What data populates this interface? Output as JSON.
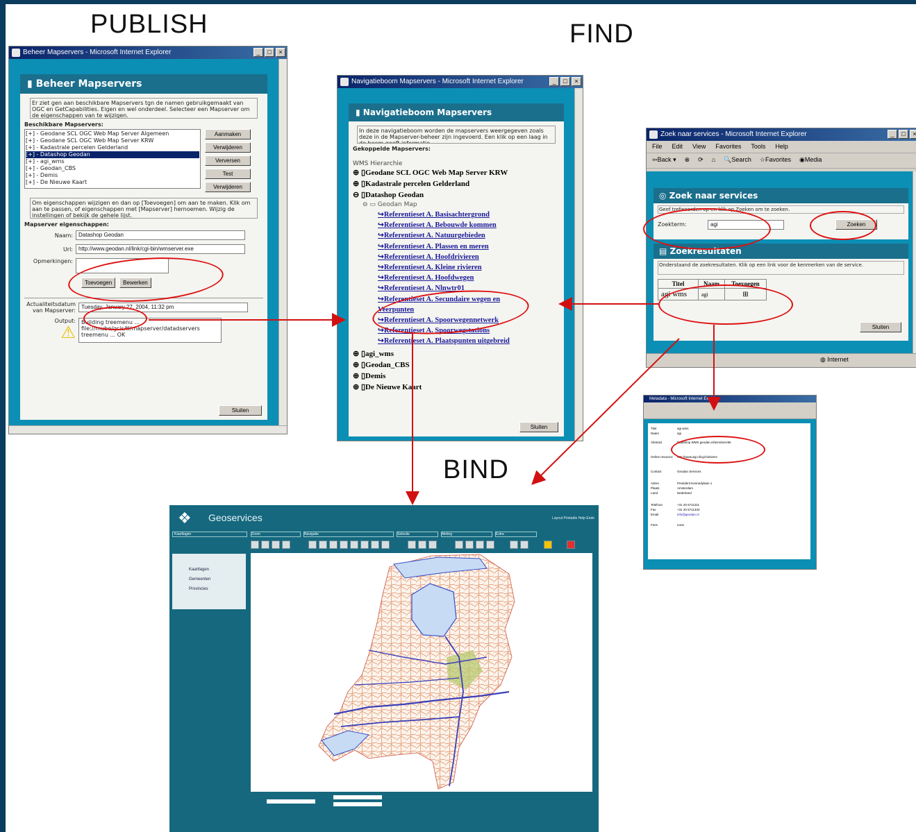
{
  "labels": {
    "publish": "PUBLISH",
    "find": "FIND",
    "bind": "BIND"
  },
  "publish_window": {
    "title": "Beheer Mapservers - Microsoft Internet Explorer",
    "panel_title": "Beheer Mapservers",
    "intro": "Er ziet gen aan beschikbare Mapservers tgn de namen gebruikgemaakt van OGC en GetCapabilities. Eigen en wel onderdeel. Selecteer een Mapserver om de eigenschappen van te wijzigen.",
    "list_label": "Beschikbare Mapservers:",
    "servers": [
      "Geodane SCL OGC Web Map Server Algemeen",
      "Geodane SCL OGC Web Map Server KRW",
      "Kadastrale percelen Gelderland",
      "Datashop Geodan",
      "agi_wms",
      "Geodan_CBS",
      "Demis",
      "De Nieuwe Kaart"
    ],
    "selected_server": "Datashop Geodan",
    "side_buttons": [
      "Aanmaken",
      "Verwijderen",
      "Verversen",
      "Test",
      "Verwijderen"
    ],
    "help_text": "Om eigenschappen wijzigen en dan op [Toevoegen] om aan te maken. Klik om aan te passen, of eigenschappen met [Mapserver] hernoemen. Wijzig de instellingen of bekijk de gehele lijst.",
    "properties_label": "Mapserver eigenschappen:",
    "name_label": "Naam:",
    "name_value": "Datashop Geodan",
    "url_label": "Url:",
    "url_value": "http://www.geodan.nl/link/cgi-bin/wmserver.exe",
    "remarks_label": "Opmerkingen:",
    "add_button": "Toevoegen",
    "modify_button": "Bewerken",
    "updated_label": "Actualiteitsdatum van Mapserver:",
    "updated_value": "Tuesday, January 27, 2004, 11:32 pm",
    "output_label": "Output:",
    "output_lines": [
      "Building treemenu ...",
      "file://mube/gcis/tl/mapserver/datadservers",
      "treemenu ... OK"
    ],
    "close_button": "Sluiten"
  },
  "nav_window": {
    "title": "Navigatieboom Mapservers - Microsoft Internet Explorer",
    "panel_title": "Navigatieboom Mapservers",
    "intro": "In deze navigatieboom worden de mapservers weergegeven zoals deze in de Mapserver-beheer zijn ingevoerd. Een klik op een laag in de boom geeft informatie.",
    "linked_label": "Gekoppelde Mapservers:",
    "hierarchy_label": "WMS Hierarchie",
    "nodes_top": [
      "Geodane SCL OGC Web Map Server KRW",
      "Kadastrale percelen Gelderland",
      "Datashop Geodan"
    ],
    "sub_node": "Geodan Map",
    "layers": [
      "Referentieset A. Basisachtergrond",
      "Referentieset A. Bebouwde kommen",
      "Referentieset A. Natuurgebieden",
      "Referentieset A. Plassen en meren",
      "Referentieset A. Hoofdrivieren",
      "Referentieset A. Kleine rivieren",
      "Referentieset A. Hoofdwegen",
      "Referentieset A. Nlnwtr01",
      "Referentieset A. Secundaire wegen en Veerpunten",
      "Referentieset A. Spoorwegennetwerk",
      "Referentieset A. Spoorwegstations",
      "Referentieset A. Plaatspunten uitgebreid"
    ],
    "nodes_bottom": [
      "agi_wms",
      "Geodan_CBS",
      "Demis",
      "De Nieuwe Kaart"
    ],
    "close_button": "Sluiten"
  },
  "find_window": {
    "title": "Zoek naar services - Microsoft Internet Explorer",
    "menu": [
      "File",
      "Edit",
      "View",
      "Favorites",
      "Tools",
      "Help"
    ],
    "toolbar": [
      "Back",
      "Search",
      "Favorites",
      "Media"
    ],
    "panel_title": "Zoek naar services",
    "search_hint": "Geef trefwoorden op en klik op Zoeken om te zoeken.",
    "search_label": "Zoekterm:",
    "search_value": "agi",
    "search_button": "Zoeken",
    "results_title": "Zoekresultaten",
    "results_hint": "Onderstaand de zoekresultaten. Klik op een link voor de kenmerken van de service.",
    "columns": [
      "Titel",
      "Naam",
      "Toevoegen"
    ],
    "row": {
      "title": "agi wms",
      "name": "agi"
    },
    "close_button": "Sluiten",
    "status": "Internet"
  },
  "meta_window": {
    "title": "Metadata - Microsoft Internet Explorer",
    "highlight": "Datashop WMS geodan.nl/wms/servlet",
    "rows": [
      [
        "Titel",
        "agi wms"
      ],
      [
        "Naam",
        "agi"
      ],
      [
        "Abstract",
        "Datashop WMS geodan.nl/wms/servlet"
      ],
      [
        "Online resource",
        "http://www.agi.nl/cgi-bin/wms"
      ],
      [
        "Contact",
        "Geodan Services"
      ],
      [
        "Adres",
        "President Kennedylaan 1"
      ],
      [
        "Plaats",
        "Amsterdam"
      ],
      [
        "Land",
        "Nederland"
      ],
      [
        "Telefoon",
        "+31 20 5711311"
      ],
      [
        "Fax",
        "+31 20 5711333"
      ],
      [
        "Email",
        "info@geodan.nl"
      ],
      [
        "Fees",
        "none"
      ]
    ]
  },
  "geo_window": {
    "title": "Geoservices",
    "top_links": "Layout Printable Help Ende",
    "sections": [
      "Kaartlagen",
      "Zoom",
      "Navigatie",
      "Selectie",
      "Meting",
      "Extra"
    ],
    "layers": [
      "Kaartlagen",
      "Gemeenten",
      "Provincies"
    ]
  },
  "colors": {
    "accent_red": "#d11111",
    "teal": "#0b8fb5",
    "panel_head": "#1a6f8c"
  }
}
